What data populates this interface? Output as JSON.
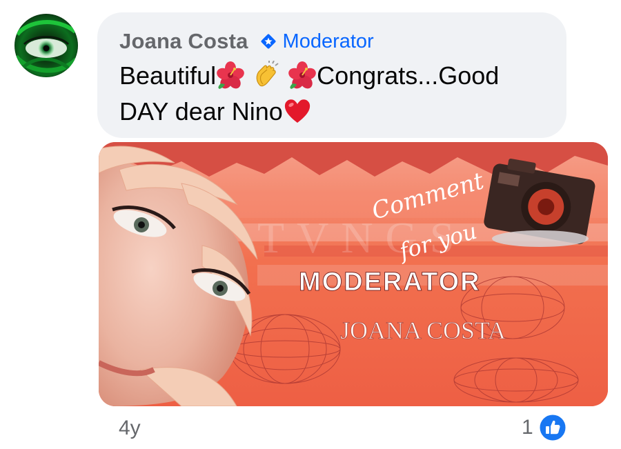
{
  "comment": {
    "author": "Joana Costa",
    "badge": "Moderator",
    "text_parts": {
      "word1": "Beautiful",
      "word2": "Congrats...Good",
      "line2": "DAY dear Nino"
    },
    "emojis": [
      "hibiscus-emoji",
      "clapping-hands-emoji",
      "hibiscus-emoji",
      "red-heart-emoji"
    ],
    "timestamp": "4y",
    "reaction_count": "1"
  },
  "attachment": {
    "text_comment": "Comment",
    "text_for_you": "for you",
    "text_title": "MODERATOR",
    "text_name": "JOANA COSTA"
  },
  "colors": {
    "bubble_bg": "#f0f2f5",
    "author_gray": "#65676b",
    "accent_blue": "#0866ff",
    "text_dark": "#050505"
  }
}
